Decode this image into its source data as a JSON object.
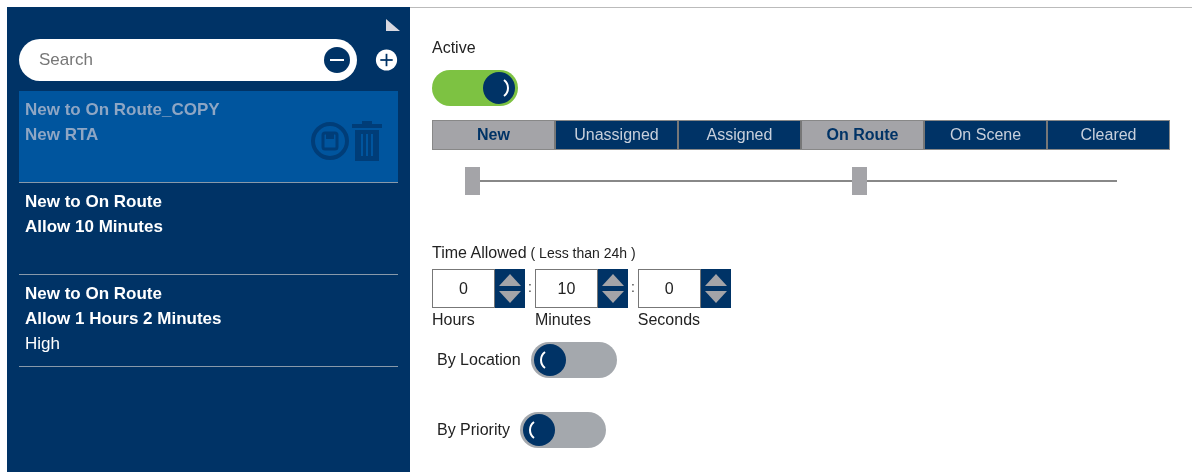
{
  "sidebar": {
    "search": {
      "placeholder": "Search"
    },
    "items": [
      {
        "title": "New to On Route_COPY",
        "detail": "New RTA",
        "selected": true
      },
      {
        "title": "New to On Route",
        "detail": "Allow 10 Minutes",
        "selected": false
      },
      {
        "title": "New to On Route",
        "detail": "Allow 1 Hours 2 Minutes",
        "priority": "High",
        "selected": false
      }
    ]
  },
  "active": {
    "label": "Active",
    "on": true
  },
  "stages": [
    {
      "label": "New",
      "selected": true
    },
    {
      "label": "Unassigned",
      "selected": false
    },
    {
      "label": "Assigned",
      "selected": false
    },
    {
      "label": "On Route",
      "selected": true
    },
    {
      "label": "On Scene",
      "selected": false
    },
    {
      "label": "Cleared",
      "selected": false
    }
  ],
  "range": {
    "start": {
      "level": 0
    },
    "end": {
      "level": 0.6
    }
  },
  "time_allowed": {
    "label": "Time Allowed",
    "hint": "( Less than 24h )",
    "separator": ":",
    "fields": [
      {
        "value": "0",
        "label": "Hours"
      },
      {
        "value": "10",
        "label": "Minutes"
      },
      {
        "value": "0",
        "label": "Seconds"
      }
    ]
  },
  "toggles": [
    {
      "label": "By Location",
      "on": false
    },
    {
      "label": "By Priority",
      "on": false
    }
  ]
}
